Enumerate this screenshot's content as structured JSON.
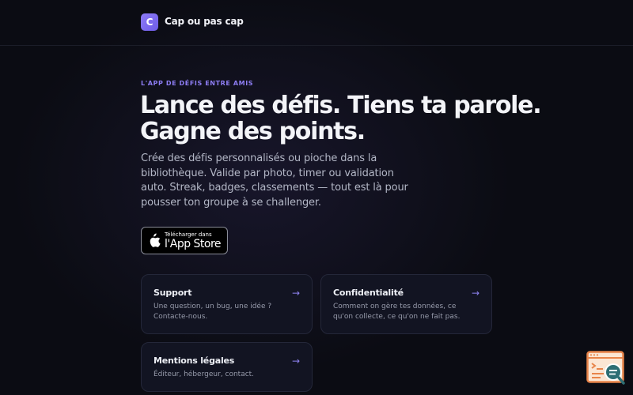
{
  "header": {
    "logo_letter": "C",
    "brand_name": "Cap ou pas cap"
  },
  "hero": {
    "eyebrow": "L'APP DE DÉFIS ENTRE AMIS",
    "title_line1": "Lance des défis. Tiens ta parole.",
    "title_line2": "Gagne des points.",
    "description": "Crée des défis personnalisés ou pioche dans la bibliothèque. Valide par photo, timer ou validation auto. Streak, badges, classements — tout est là pour pousser ton groupe à se challenger."
  },
  "app_store_button": {
    "small_label": "Télécharger dans",
    "big_label": "l'App Store",
    "icon": "apple-icon"
  },
  "cards": [
    {
      "title": "Support",
      "description": "Une question, un bug, une idée ? Contacte-nous.",
      "arrow": "→"
    },
    {
      "title": "Confidentialité",
      "description": "Comment on gère tes données, ce qu'on collecte, ce qu'on ne fait pas.",
      "arrow": "→"
    },
    {
      "title": "Mentions légales",
      "description": "Éditeur, hébergeur, contact.",
      "arrow": "→"
    }
  ],
  "colors": {
    "background": "#0b0c13",
    "accent": "#8d7df3",
    "logo_gradient_start": "#8d7bf6",
    "logo_gradient_end": "#6e5ce8",
    "card_background": "#121422",
    "card_border": "#242739",
    "widget_orange": "#e8844a",
    "widget_teal": "#2e6e74"
  },
  "corner_widget": {
    "icon": "browser-search-icon"
  }
}
